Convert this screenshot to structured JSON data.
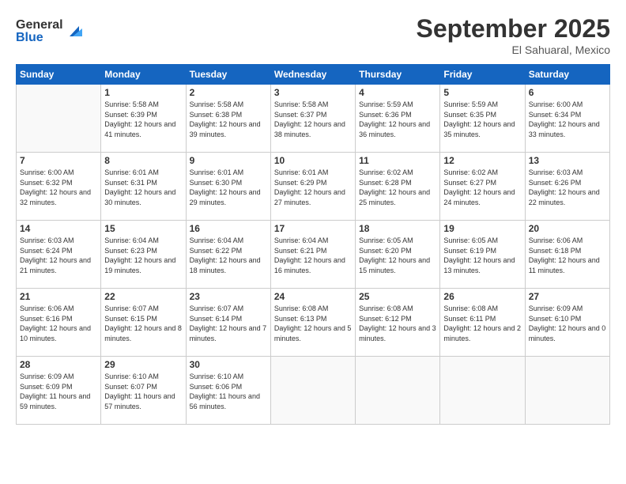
{
  "header": {
    "logo_line1": "General",
    "logo_line2": "Blue",
    "month_title": "September 2025",
    "location": "El Sahuaral, Mexico"
  },
  "days_of_week": [
    "Sunday",
    "Monday",
    "Tuesday",
    "Wednesday",
    "Thursday",
    "Friday",
    "Saturday"
  ],
  "weeks": [
    [
      {
        "day": "",
        "sunrise": "",
        "sunset": "",
        "daylight": ""
      },
      {
        "day": "1",
        "sunrise": "Sunrise: 5:58 AM",
        "sunset": "Sunset: 6:39 PM",
        "daylight": "Daylight: 12 hours and 41 minutes."
      },
      {
        "day": "2",
        "sunrise": "Sunrise: 5:58 AM",
        "sunset": "Sunset: 6:38 PM",
        "daylight": "Daylight: 12 hours and 39 minutes."
      },
      {
        "day": "3",
        "sunrise": "Sunrise: 5:58 AM",
        "sunset": "Sunset: 6:37 PM",
        "daylight": "Daylight: 12 hours and 38 minutes."
      },
      {
        "day": "4",
        "sunrise": "Sunrise: 5:59 AM",
        "sunset": "Sunset: 6:36 PM",
        "daylight": "Daylight: 12 hours and 36 minutes."
      },
      {
        "day": "5",
        "sunrise": "Sunrise: 5:59 AM",
        "sunset": "Sunset: 6:35 PM",
        "daylight": "Daylight: 12 hours and 35 minutes."
      },
      {
        "day": "6",
        "sunrise": "Sunrise: 6:00 AM",
        "sunset": "Sunset: 6:34 PM",
        "daylight": "Daylight: 12 hours and 33 minutes."
      }
    ],
    [
      {
        "day": "7",
        "sunrise": "Sunrise: 6:00 AM",
        "sunset": "Sunset: 6:32 PM",
        "daylight": "Daylight: 12 hours and 32 minutes."
      },
      {
        "day": "8",
        "sunrise": "Sunrise: 6:01 AM",
        "sunset": "Sunset: 6:31 PM",
        "daylight": "Daylight: 12 hours and 30 minutes."
      },
      {
        "day": "9",
        "sunrise": "Sunrise: 6:01 AM",
        "sunset": "Sunset: 6:30 PM",
        "daylight": "Daylight: 12 hours and 29 minutes."
      },
      {
        "day": "10",
        "sunrise": "Sunrise: 6:01 AM",
        "sunset": "Sunset: 6:29 PM",
        "daylight": "Daylight: 12 hours and 27 minutes."
      },
      {
        "day": "11",
        "sunrise": "Sunrise: 6:02 AM",
        "sunset": "Sunset: 6:28 PM",
        "daylight": "Daylight: 12 hours and 25 minutes."
      },
      {
        "day": "12",
        "sunrise": "Sunrise: 6:02 AM",
        "sunset": "Sunset: 6:27 PM",
        "daylight": "Daylight: 12 hours and 24 minutes."
      },
      {
        "day": "13",
        "sunrise": "Sunrise: 6:03 AM",
        "sunset": "Sunset: 6:26 PM",
        "daylight": "Daylight: 12 hours and 22 minutes."
      }
    ],
    [
      {
        "day": "14",
        "sunrise": "Sunrise: 6:03 AM",
        "sunset": "Sunset: 6:24 PM",
        "daylight": "Daylight: 12 hours and 21 minutes."
      },
      {
        "day": "15",
        "sunrise": "Sunrise: 6:04 AM",
        "sunset": "Sunset: 6:23 PM",
        "daylight": "Daylight: 12 hours and 19 minutes."
      },
      {
        "day": "16",
        "sunrise": "Sunrise: 6:04 AM",
        "sunset": "Sunset: 6:22 PM",
        "daylight": "Daylight: 12 hours and 18 minutes."
      },
      {
        "day": "17",
        "sunrise": "Sunrise: 6:04 AM",
        "sunset": "Sunset: 6:21 PM",
        "daylight": "Daylight: 12 hours and 16 minutes."
      },
      {
        "day": "18",
        "sunrise": "Sunrise: 6:05 AM",
        "sunset": "Sunset: 6:20 PM",
        "daylight": "Daylight: 12 hours and 15 minutes."
      },
      {
        "day": "19",
        "sunrise": "Sunrise: 6:05 AM",
        "sunset": "Sunset: 6:19 PM",
        "daylight": "Daylight: 12 hours and 13 minutes."
      },
      {
        "day": "20",
        "sunrise": "Sunrise: 6:06 AM",
        "sunset": "Sunset: 6:18 PM",
        "daylight": "Daylight: 12 hours and 11 minutes."
      }
    ],
    [
      {
        "day": "21",
        "sunrise": "Sunrise: 6:06 AM",
        "sunset": "Sunset: 6:16 PM",
        "daylight": "Daylight: 12 hours and 10 minutes."
      },
      {
        "day": "22",
        "sunrise": "Sunrise: 6:07 AM",
        "sunset": "Sunset: 6:15 PM",
        "daylight": "Daylight: 12 hours and 8 minutes."
      },
      {
        "day": "23",
        "sunrise": "Sunrise: 6:07 AM",
        "sunset": "Sunset: 6:14 PM",
        "daylight": "Daylight: 12 hours and 7 minutes."
      },
      {
        "day": "24",
        "sunrise": "Sunrise: 6:08 AM",
        "sunset": "Sunset: 6:13 PM",
        "daylight": "Daylight: 12 hours and 5 minutes."
      },
      {
        "day": "25",
        "sunrise": "Sunrise: 6:08 AM",
        "sunset": "Sunset: 6:12 PM",
        "daylight": "Daylight: 12 hours and 3 minutes."
      },
      {
        "day": "26",
        "sunrise": "Sunrise: 6:08 AM",
        "sunset": "Sunset: 6:11 PM",
        "daylight": "Daylight: 12 hours and 2 minutes."
      },
      {
        "day": "27",
        "sunrise": "Sunrise: 6:09 AM",
        "sunset": "Sunset: 6:10 PM",
        "daylight": "Daylight: 12 hours and 0 minutes."
      }
    ],
    [
      {
        "day": "28",
        "sunrise": "Sunrise: 6:09 AM",
        "sunset": "Sunset: 6:09 PM",
        "daylight": "Daylight: 11 hours and 59 minutes."
      },
      {
        "day": "29",
        "sunrise": "Sunrise: 6:10 AM",
        "sunset": "Sunset: 6:07 PM",
        "daylight": "Daylight: 11 hours and 57 minutes."
      },
      {
        "day": "30",
        "sunrise": "Sunrise: 6:10 AM",
        "sunset": "Sunset: 6:06 PM",
        "daylight": "Daylight: 11 hours and 56 minutes."
      },
      {
        "day": "",
        "sunrise": "",
        "sunset": "",
        "daylight": ""
      },
      {
        "day": "",
        "sunrise": "",
        "sunset": "",
        "daylight": ""
      },
      {
        "day": "",
        "sunrise": "",
        "sunset": "",
        "daylight": ""
      },
      {
        "day": "",
        "sunrise": "",
        "sunset": "",
        "daylight": ""
      }
    ]
  ]
}
